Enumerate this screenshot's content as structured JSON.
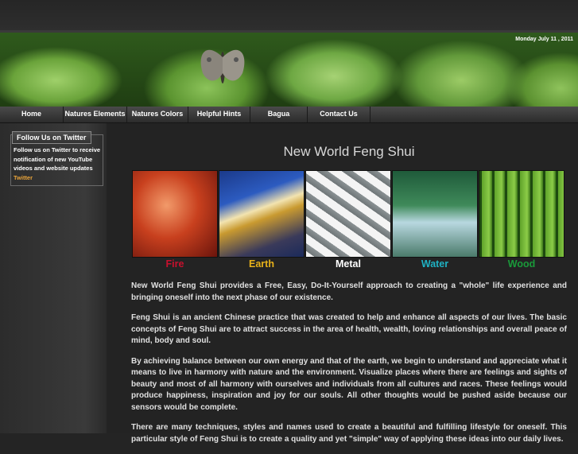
{
  "banner": {
    "date": "Monday July 11 , 2011"
  },
  "nav": [
    {
      "label": "Home"
    },
    {
      "label": "Natures Elements"
    },
    {
      "label": "Natures Colors"
    },
    {
      "label": "Helpful Hints"
    },
    {
      "label": "Bagua"
    },
    {
      "label": "Contact Us"
    }
  ],
  "sidebar": {
    "title": "Follow Us on Twitter",
    "text": "Follow us on Twitter to receive notification of new YouTube videos and website updates",
    "link": "Twitter"
  },
  "main": {
    "title": "New World Feng Shui",
    "elements": [
      {
        "label": "Fire",
        "color": "#c8102e"
      },
      {
        "label": "Earth",
        "color": "#e8b21a"
      },
      {
        "label": "Metal",
        "color": "#ffffff"
      },
      {
        "label": "Water",
        "color": "#1fb2c4"
      },
      {
        "label": "Wood",
        "color": "#1a9a3a"
      }
    ],
    "paragraphs": [
      "New World Feng Shui provides a Free, Easy, Do-It-Yourself approach to creating a \"whole\" life experience and bringing oneself into the next phase of our existence.",
      "Feng Shui is an ancient Chinese practice that was created to help and enhance all aspects of our lives. The basic concepts of Feng Shui are to attract success in the area of health, wealth, loving relationships and overall peace of mind, body and soul.",
      "By achieving balance between our own energy and that of the earth, we begin to understand and appreciate what it means to live in harmony with nature and the environment. Visualize places where there are feelings and sights of beauty and most of all harmony with ourselves and individuals from all cultures and races. These feelings would produce happiness, inspiration and joy for our souls. All other thoughts would be pushed aside because our sensors would be complete.",
      "There are many techniques, styles and names used to create a beautiful and fulfilling lifestyle for oneself. This particular style of Feng Shui is to create a quality and yet \"simple\" way of applying these ideas into our daily lives."
    ]
  }
}
